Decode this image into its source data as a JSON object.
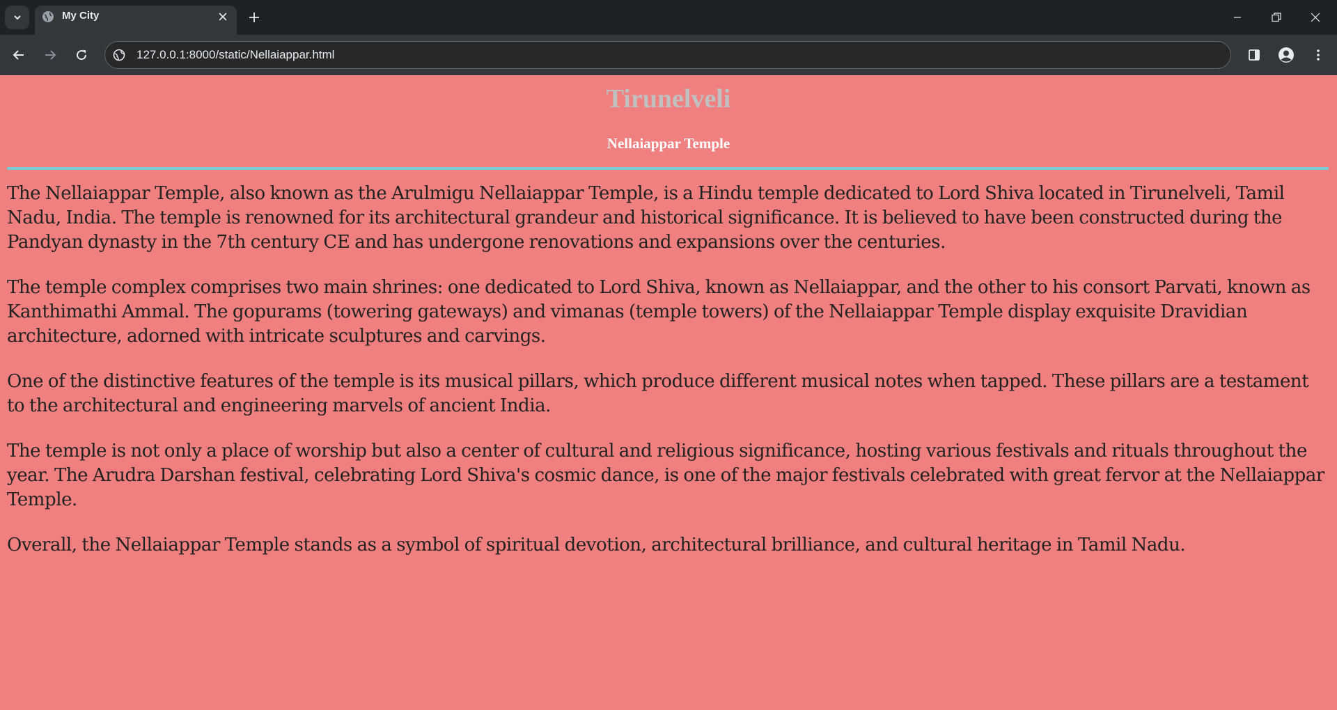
{
  "browser": {
    "tab_title": "My City",
    "url": "127.0.0.1:8000/static/Nellaiappar.html"
  },
  "page": {
    "title": "Tirunelveli",
    "subtitle": "Nellaiappar Temple",
    "paragraphs": [
      "The Nellaiappar Temple, also known as the Arulmigu Nellaiappar Temple, is a Hindu temple dedicated to Lord Shiva located in Tirunelveli, Tamil Nadu, India. The temple is renowned for its architectural grandeur and historical significance. It is believed to have been constructed during the Pandyan dynasty in the 7th century CE and has undergone renovations and expansions over the centuries.",
      "The temple complex comprises two main shrines: one dedicated to Lord Shiva, known as Nellaiappar, and the other to his consort Parvati, known as Kanthimathi Ammal. The gopurams (towering gateways) and vimanas (temple towers) of the Nellaiappar Temple display exquisite Dravidian architecture, adorned with intricate sculptures and carvings.",
      "One of the distinctive features of the temple is its musical pillars, which produce different musical notes when tapped. These pillars are a testament to the architectural and engineering marvels of ancient India.",
      "The temple is not only a place of worship but also a center of cultural and religious significance, hosting various festivals and rituals throughout the year. The Arudra Darshan festival, celebrating Lord Shiva's cosmic dance, is one of the major festivals celebrated with great fervor at the Nellaiappar Temple.",
      "Overall, the Nellaiappar Temple stands as a symbol of spiritual devotion, architectural brilliance, and cultural heritage in Tamil Nadu."
    ]
  },
  "colors": {
    "page_background": "#f08080",
    "title_color": "#c0c0c0",
    "subtitle_color": "#ffffff",
    "rule_color": "#7fc9d4",
    "browser_frame": "#202124"
  },
  "icons": [
    "tab-search-icon",
    "globe-favicon-icon",
    "close-icon",
    "plus-icon",
    "minimize-icon",
    "restore-icon",
    "back-arrow-icon",
    "forward-arrow-icon",
    "reload-icon",
    "site-info-icon",
    "side-panel-icon",
    "profile-icon",
    "menu-dots-icon"
  ]
}
